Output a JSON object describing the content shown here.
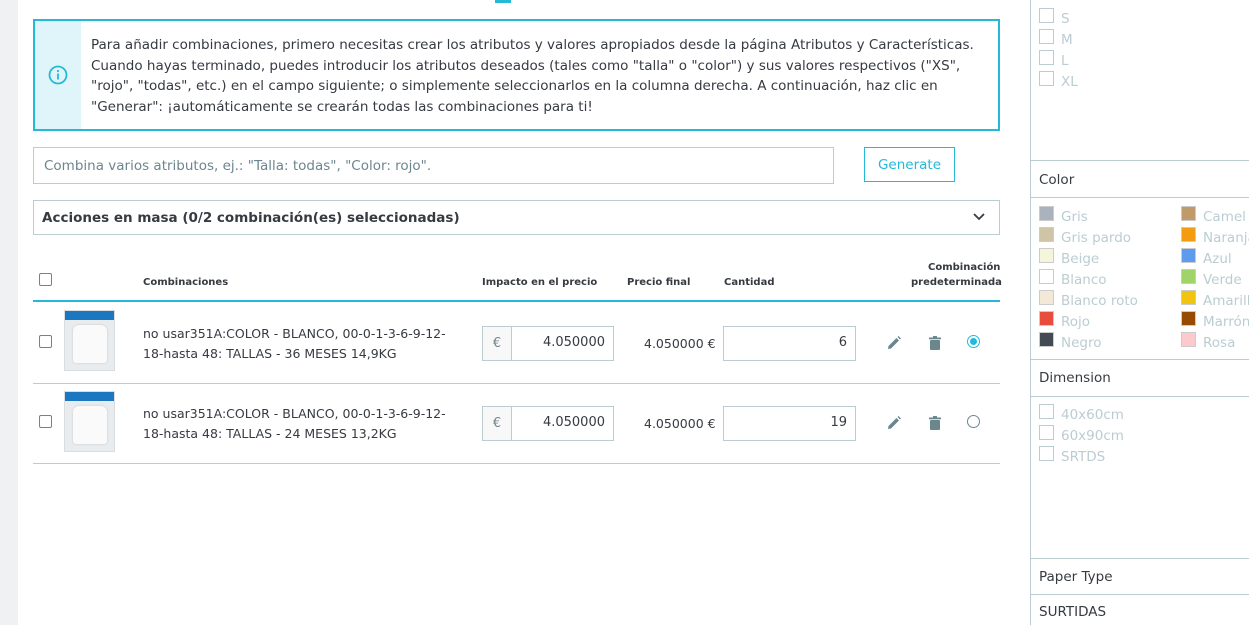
{
  "info": {
    "text": "Para añadir combinaciones, primero necesitas crear los atributos y valores apropiados desde la página Atributos y Características. Cuando hayas terminado, puedes introducir los atributos deseados (tales como \"talla\" o \"color\") y sus valores respectivos (\"XS\", \"rojo\", \"todas\", etc.) en el campo siguiente; o simplemente seleccionarlos en la columna derecha. A continuación, haz clic en \"Generar\": ¡automáticamente se crearán todas las combinaciones para ti!"
  },
  "combine": {
    "placeholder": "Combina varios atributos, ej.: \"Talla: todas\", \"Color: rojo\".",
    "generate_label": "Generate"
  },
  "bulk": {
    "label": "Acciones en masa (0/2 combinación(es) seleccionadas)"
  },
  "table": {
    "headers": {
      "combinations": "Combinaciones",
      "impact": "Impacto en el precio",
      "final": "Precio final",
      "quantity": "Cantidad",
      "default_1": "Combinación",
      "default_2": "predeterminada"
    },
    "rows": [
      {
        "name": "no usar351A:COLOR - BLANCO, 00-0-1-3-6-9-12-18-hasta 48: TALLAS - 36 MESES 14,9KG",
        "currency": "€",
        "impact": "4.050000",
        "final": "4.050000 €",
        "quantity": "6",
        "default": true
      },
      {
        "name": "no usar351A:COLOR - BLANCO, 00-0-1-3-6-9-12-18-hasta 48: TALLAS - 24 MESES 13,2KG",
        "currency": "€",
        "impact": "4.050000",
        "final": "4.050000 €",
        "quantity": "19",
        "default": false
      }
    ]
  },
  "sidebar": {
    "sizes": [
      "S",
      "M",
      "L",
      "XL"
    ],
    "color_title": "Color",
    "colors_left": [
      {
        "name": "Gris",
        "hex": "#aab2bd"
      },
      {
        "name": "Gris pardo",
        "hex": "#cfc4a6"
      },
      {
        "name": "Beige",
        "hex": "#f5f5dc"
      },
      {
        "name": "Blanco",
        "hex": "#ffffff"
      },
      {
        "name": "Blanco roto",
        "hex": "#f4e9d8"
      },
      {
        "name": "Rojo",
        "hex": "#e84c3d"
      },
      {
        "name": "Negro",
        "hex": "#434a54"
      }
    ],
    "colors_right": [
      {
        "name": "Camel",
        "hex": "#c19a6b"
      },
      {
        "name": "Naranja",
        "hex": "#f39c11"
      },
      {
        "name": "Azul",
        "hex": "#5d9cec"
      },
      {
        "name": "Verde",
        "hex": "#a0d468"
      },
      {
        "name": "Amarillo",
        "hex": "#f1c40f"
      },
      {
        "name": "Marrón",
        "hex": "#964b00"
      },
      {
        "name": "Rosa",
        "hex": "#fccacd"
      }
    ],
    "dimension_title": "Dimension",
    "dimensions": [
      "40x60cm",
      "60x90cm",
      "SRTDS"
    ],
    "paper_title": "Paper Type",
    "surtidas_title": "SURTIDAS"
  }
}
